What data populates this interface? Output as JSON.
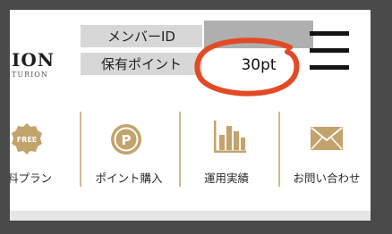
{
  "header": {
    "logo_main": "ION",
    "logo_sub": "TURION",
    "member_id_label": "メンバーID",
    "member_id_value": "",
    "points_label": "保有ポイント",
    "points_value": "30pt"
  },
  "nav": {
    "items": [
      {
        "label": "料プラン",
        "badge": "FREE",
        "icon": "free-badge-icon"
      },
      {
        "label": "ポイント購入",
        "badge": "P",
        "icon": "point-coin-icon"
      },
      {
        "label": "運用実績",
        "icon": "bar-chart-icon"
      },
      {
        "label": "お問い合わせ",
        "icon": "envelope-icon"
      }
    ]
  },
  "colors": {
    "accent_gold": "#c2a36b",
    "divider_gold": "#d2b98d",
    "annotation_red": "#e24a25",
    "label_bg": "#d7d7d7",
    "masked_bg": "#afafaf",
    "frame": "#4a4a4a"
  }
}
